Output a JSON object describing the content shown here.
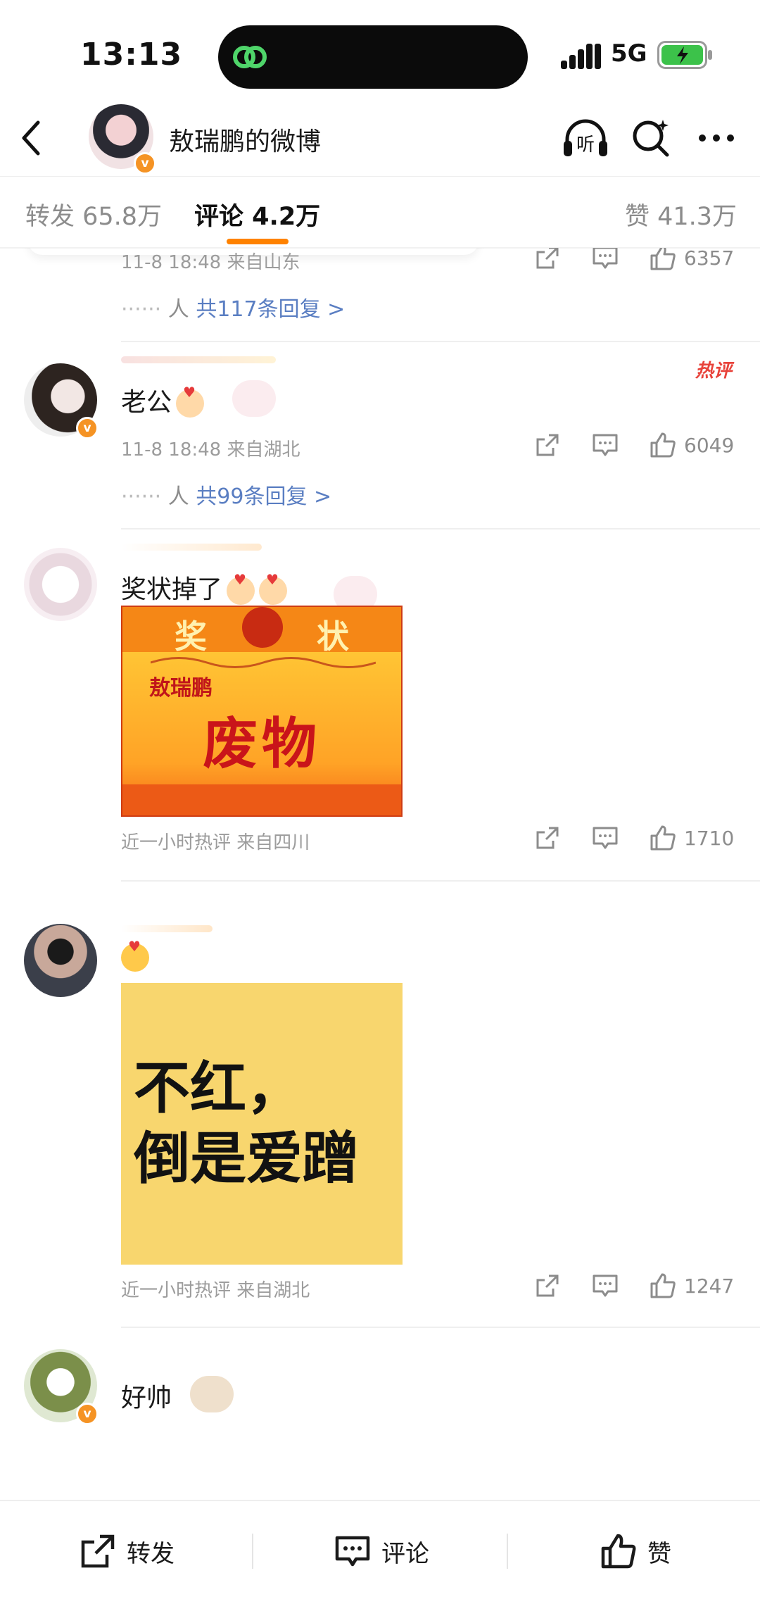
{
  "status_bar": {
    "time": "13:13",
    "network": "5G",
    "battery_color": "#3cc24a"
  },
  "nav": {
    "title": "敖瑞鹏的微博",
    "verified_badge": "v"
  },
  "tabs": {
    "repost": "转发 65.8万",
    "comment": "评论 4.2万",
    "like": "赞 41.3万",
    "active_color": "#ff8200"
  },
  "comments": [
    {
      "meta": "11-8 18:48 来自山东",
      "likes": "6357",
      "reply_prefix": "人 ",
      "reply_link": "共117条回复 >"
    },
    {
      "text": "老公",
      "hot_badge": "热评",
      "meta": "11-8 18:48 来自湖北",
      "likes": "6049",
      "reply_prefix": "人 ",
      "reply_link": "共99条回复 >"
    },
    {
      "text": "奖状掉了",
      "image": {
        "title": "奖 状",
        "name": "敖瑞鹏",
        "big": "废物"
      },
      "meta": "近一小时热评  来自四川",
      "likes": "1710"
    },
    {
      "image": {
        "line1": "不红，",
        "line2": "倒是爱蹭"
      },
      "meta": "近一小时热评  来自湖北",
      "likes": "1247"
    },
    {
      "text": "好帅"
    }
  ],
  "bottom_bar": {
    "repost": "转发",
    "comment": "评论",
    "like": "赞"
  }
}
